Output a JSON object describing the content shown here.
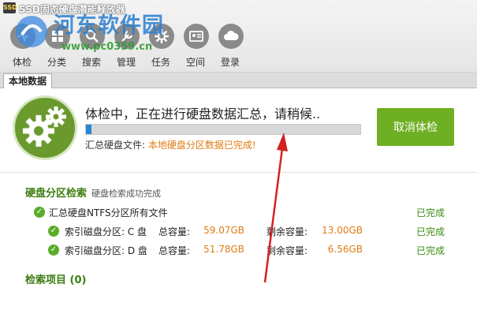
{
  "window": {
    "title": "SSD固态硬盘潜能释放器",
    "logo_text": "SSD"
  },
  "watermark": {
    "text": "河东软件园",
    "url": "www.pc0359.cn"
  },
  "toolbar": [
    {
      "label": "体检",
      "icon": "health-check-icon"
    },
    {
      "label": "分类",
      "icon": "category-icon"
    },
    {
      "label": "搜索",
      "icon": "search-icon"
    },
    {
      "label": "管理",
      "icon": "manage-icon"
    },
    {
      "label": "任务",
      "icon": "task-gear-icon"
    },
    {
      "label": "空间",
      "icon": "space-card-icon"
    },
    {
      "label": "登录",
      "icon": "cloud-login-icon"
    }
  ],
  "tabs": {
    "local": "本地数据"
  },
  "status": {
    "message": "体检中，正在进行硬盘数据汇总，请稍候..",
    "progress": 0.02,
    "summary_label": "汇总硬盘文件: ",
    "summary_value": "本地硬盘分区数据已完成!",
    "cancel_label": "取消体检"
  },
  "results": {
    "partition_title": "硬盘分区检索",
    "partition_sub": "硬盘检索成功完成",
    "summary_row": {
      "label": "汇总硬盘NTFS分区所有文件",
      "status": "已完成"
    },
    "drives": [
      {
        "label": "索引磁盘分区: C 盘",
        "total_label": "总容量:",
        "total": "59.07GB",
        "free_label": "剩余容量:",
        "free": "13.00GB",
        "status": "已完成"
      },
      {
        "label": "索引磁盘分区: D 盘",
        "total_label": "总容量:",
        "total": "51.78GB",
        "free_label": "剩余容量:",
        "free": "6.56GB",
        "status": "已完成"
      }
    ],
    "items_title": "检索项目 (0)"
  },
  "colors": {
    "accent_green": "#6faf24",
    "value_orange": "#e07b14",
    "progress_blue": "#2a86d4",
    "annotation_red": "#d42020"
  }
}
